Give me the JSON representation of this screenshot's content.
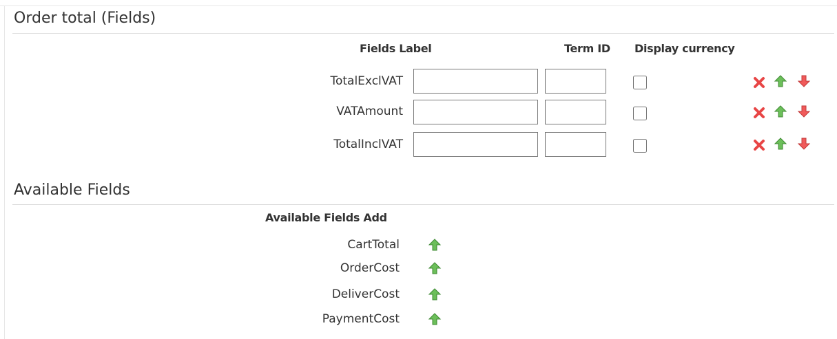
{
  "order_total": {
    "title": "Order total (Fields)",
    "headers": {
      "fields_label": "Fields Label",
      "term_id": "Term ID",
      "display_currency": "Display currency"
    },
    "rows": [
      {
        "name": "TotalExclVAT",
        "label_value": "",
        "term_id_value": "",
        "display_currency": false
      },
      {
        "name": "VATAmount",
        "label_value": "",
        "term_id_value": "",
        "display_currency": false
      },
      {
        "name": "TotalInclVAT",
        "label_value": "",
        "term_id_value": "",
        "display_currency": false
      }
    ],
    "row_icons": [
      "delete-icon",
      "move-up-icon",
      "move-down-icon"
    ]
  },
  "available_fields": {
    "title": "Available Fields",
    "header": "Available Fields Add",
    "items": [
      {
        "name": "CartTotal"
      },
      {
        "name": "OrderCost"
      },
      {
        "name": "DeliverCost"
      },
      {
        "name": "PaymentCost"
      }
    ],
    "item_icon": "add-up-arrow-icon"
  },
  "colors": {
    "delete": "#e84545",
    "up_arrow": "#5aa84a",
    "down_arrow": "#e84545",
    "rule": "#dcdcdc"
  }
}
